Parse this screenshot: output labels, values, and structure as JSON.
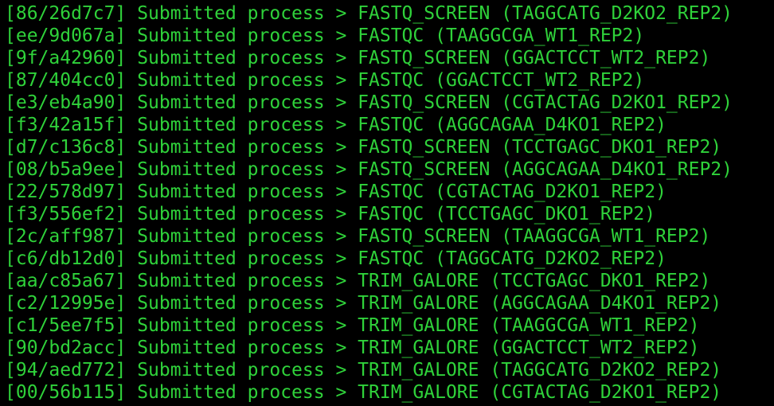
{
  "terminal": {
    "lines": [
      {
        "hash": "[86/26d7c7]",
        "status": "Submitted process",
        "arrow": ">",
        "process": "FASTQ_SCREEN",
        "sample": "(TAGGCATG_D2KO2_REP2)"
      },
      {
        "hash": "[ee/9d067a]",
        "status": "Submitted process",
        "arrow": ">",
        "process": "FASTQC",
        "sample": "(TAAGGCGA_WT1_REP2)"
      },
      {
        "hash": "[9f/a42960]",
        "status": "Submitted process",
        "arrow": ">",
        "process": "FASTQ_SCREEN",
        "sample": "(GGACTCCT_WT2_REP2)"
      },
      {
        "hash": "[87/404cc0]",
        "status": "Submitted process",
        "arrow": ">",
        "process": "FASTQC",
        "sample": "(GGACTCCT_WT2_REP2)"
      },
      {
        "hash": "[e3/eb4a90]",
        "status": "Submitted process",
        "arrow": ">",
        "process": "FASTQ_SCREEN",
        "sample": "(CGTACTAG_D2KO1_REP2)"
      },
      {
        "hash": "[f3/42a15f]",
        "status": "Submitted process",
        "arrow": ">",
        "process": "FASTQC",
        "sample": "(AGGCAGAA_D4KO1_REP2)"
      },
      {
        "hash": "[d7/c136c8]",
        "status": "Submitted process",
        "arrow": ">",
        "process": "FASTQ_SCREEN",
        "sample": "(TCCTGAGC_DKO1_REP2)"
      },
      {
        "hash": "[08/b5a9ee]",
        "status": "Submitted process",
        "arrow": ">",
        "process": "FASTQ_SCREEN",
        "sample": "(AGGCAGAA_D4KO1_REP2)"
      },
      {
        "hash": "[22/578d97]",
        "status": "Submitted process",
        "arrow": ">",
        "process": "FASTQC",
        "sample": "(CGTACTAG_D2KO1_REP2)"
      },
      {
        "hash": "[f3/556ef2]",
        "status": "Submitted process",
        "arrow": ">",
        "process": "FASTQC",
        "sample": "(TCCTGAGC_DKO1_REP2)"
      },
      {
        "hash": "[2c/aff987]",
        "status": "Submitted process",
        "arrow": ">",
        "process": "FASTQ_SCREEN",
        "sample": "(TAAGGCGA_WT1_REP2)"
      },
      {
        "hash": "[c6/db12d0]",
        "status": "Submitted process",
        "arrow": ">",
        "process": "FASTQC",
        "sample": "(TAGGCATG_D2KO2_REP2)"
      },
      {
        "hash": "[aa/c85a67]",
        "status": "Submitted process",
        "arrow": ">",
        "process": "TRIM_GALORE",
        "sample": "(TCCTGAGC_DKO1_REP2)"
      },
      {
        "hash": "[c2/12995e]",
        "status": "Submitted process",
        "arrow": ">",
        "process": "TRIM_GALORE",
        "sample": "(AGGCAGAA_D4KO1_REP2)"
      },
      {
        "hash": "[c1/5ee7f5]",
        "status": "Submitted process",
        "arrow": ">",
        "process": "TRIM_GALORE",
        "sample": "(TAAGGCGA_WT1_REP2)"
      },
      {
        "hash": "[90/bd2acc]",
        "status": "Submitted process",
        "arrow": ">",
        "process": "TRIM_GALORE",
        "sample": "(GGACTCCT_WT2_REP2)"
      },
      {
        "hash": "[94/aed772]",
        "status": "Submitted process",
        "arrow": ">",
        "process": "TRIM_GALORE",
        "sample": "(TAGGCATG_D2KO2_REP2)"
      },
      {
        "hash": "[00/56b115]",
        "status": "Submitted process",
        "arrow": ">",
        "process": "TRIM_GALORE",
        "sample": "(CGTACTAG_D2KO1_REP2)"
      }
    ]
  },
  "colors": {
    "background": "#000000",
    "text": "#2fd23a"
  }
}
